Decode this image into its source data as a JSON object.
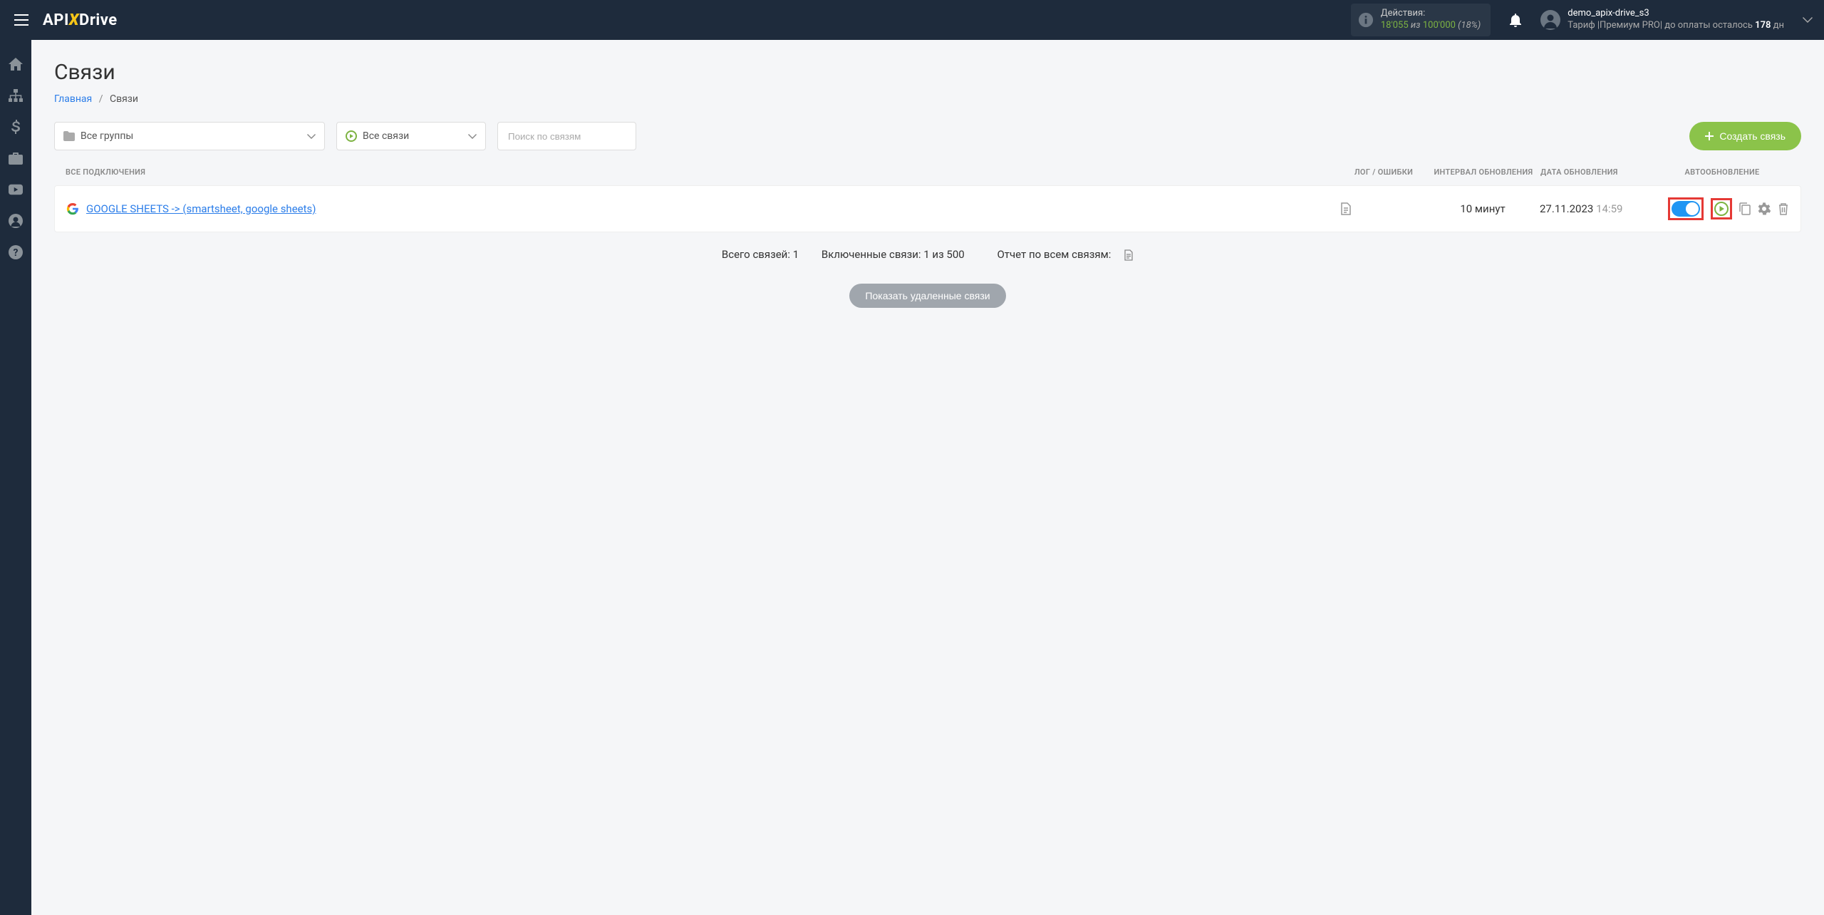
{
  "header": {
    "logo_prefix": "API",
    "logo_x": "X",
    "logo_suffix": "Drive",
    "actions_label": "Действия:",
    "actions_used": "18'055",
    "actions_of": "из",
    "actions_total": "100'000",
    "actions_pct": "(18%)",
    "user_name": "demo_apix-drive_s3",
    "tariff_prefix": "Тариф |Премиум PRO| до оплаты осталось ",
    "tariff_days": "178",
    "tariff_suffix": " дн"
  },
  "page": {
    "title": "Связи",
    "breadcrumb_home": "Главная",
    "breadcrumb_current": "Связи"
  },
  "toolbar": {
    "groups_label": "Все группы",
    "filter_label": "Все связи",
    "search_placeholder": "Поиск по связям",
    "create_label": "Создать связь"
  },
  "table": {
    "header_name": "ВСЕ ПОДКЛЮЧЕНИЯ",
    "header_log": "ЛОГ / ОШИБКИ",
    "header_interval": "ИНТЕРВАЛ ОБНОВЛЕНИЯ",
    "header_date": "ДАТА ОБНОВЛЕНИЯ",
    "header_auto": "АВТООБНОВЛЕНИЕ",
    "row": {
      "name": "GOOGLE SHEETS -> (smartsheet, google sheets)",
      "interval": "10 минут",
      "date": "27.11.2023",
      "time": "14:59"
    }
  },
  "stats": {
    "total": "Всего связей: 1",
    "enabled": "Включенные связи: 1 из 500",
    "report": "Отчет по всем связям:"
  },
  "buttons": {
    "show_deleted": "Показать удаленные связи"
  }
}
